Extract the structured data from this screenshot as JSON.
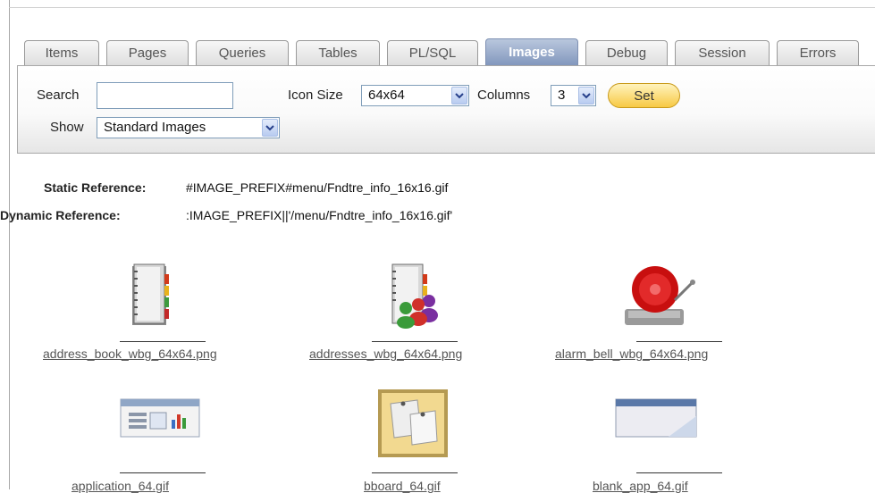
{
  "tabs": [
    {
      "label": "Items",
      "active": false
    },
    {
      "label": "Pages",
      "active": false
    },
    {
      "label": "Queries",
      "active": false
    },
    {
      "label": "Tables",
      "active": false
    },
    {
      "label": "PL/SQL",
      "active": false
    },
    {
      "label": "Images",
      "active": true
    },
    {
      "label": "Debug",
      "active": false
    },
    {
      "label": "Session",
      "active": false
    },
    {
      "label": "Errors",
      "active": false
    }
  ],
  "filters": {
    "search_label": "Search",
    "search_value": "",
    "icon_size_label": "Icon Size",
    "icon_size_value": "64x64",
    "columns_label": "Columns",
    "columns_value": "3",
    "set_label": "Set",
    "show_label": "Show",
    "show_value": "Standard Images"
  },
  "references": {
    "static_label": "Static Reference:",
    "static_value": "#IMAGE_PREFIX#menu/Fndtre_info_16x16.gif",
    "dynamic_label": "Dynamic Reference:",
    "dynamic_value": ":IMAGE_PREFIX||'/menu/Fndtre_info_16x16.gif'"
  },
  "images": [
    {
      "name": "address_book_wbg_64x64.png",
      "icon": "address-book-icon"
    },
    {
      "name": "addresses_wbg_64x64.png",
      "icon": "addresses-icon"
    },
    {
      "name": "alarm_bell_wbg_64x64.png",
      "icon": "alarm-bell-icon"
    },
    {
      "name": "application_64.gif",
      "icon": "application-icon"
    },
    {
      "name": "bboard_64.gif",
      "icon": "bboard-icon"
    },
    {
      "name": "blank_app_64.gif",
      "icon": "blank-app-icon"
    }
  ],
  "colors": {
    "active_tab": "#8297bd",
    "set_button": "#f7c944",
    "panel_border": "#a8a8a8"
  }
}
